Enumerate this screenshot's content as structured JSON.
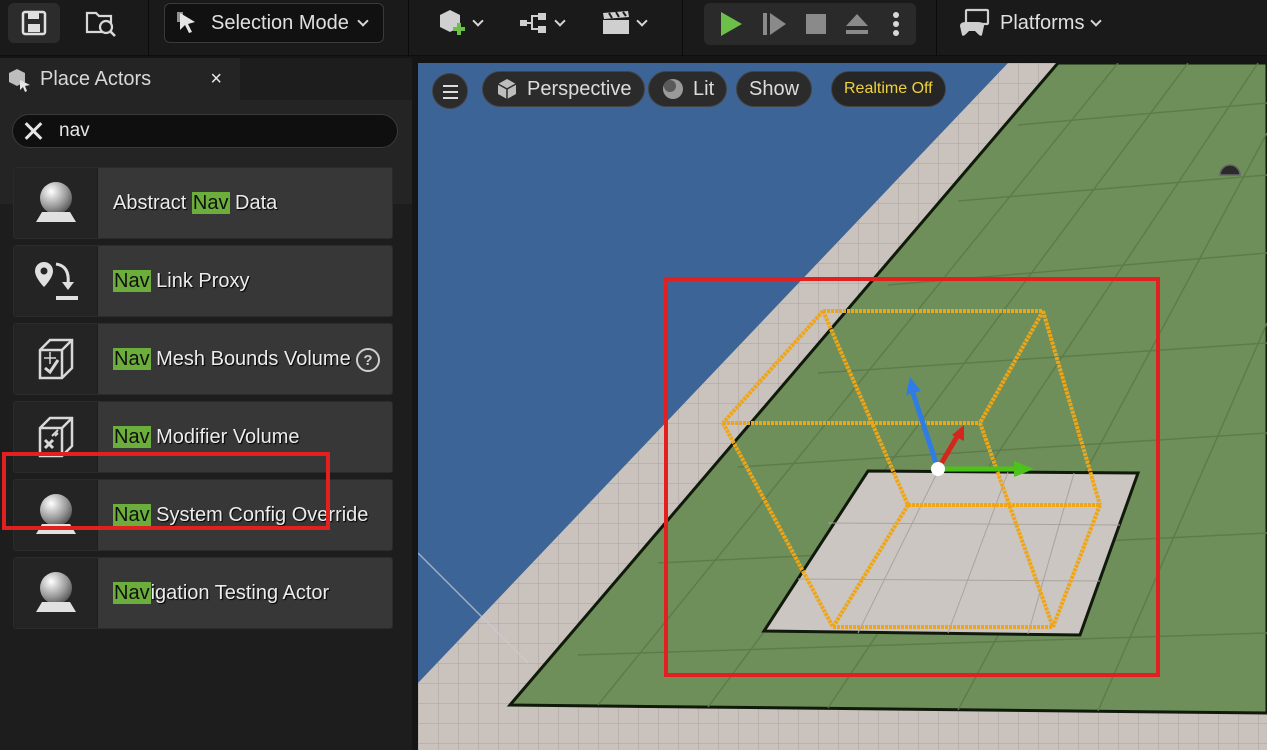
{
  "toolbar": {
    "save_icon": "save-icon",
    "content_browser_icon": "folder-search-icon",
    "selection_mode_label": "Selection Mode",
    "add_icon": "add-actor-icon",
    "blueprint_icon": "blueprint-icon",
    "cinematics_icon": "clapperboard-icon",
    "play_icon": "play-icon",
    "skip_icon": "step-forward-icon",
    "stop_icon": "stop-icon",
    "eject_icon": "eject-icon",
    "more_icon": "more-vertical-icon",
    "platforms_label": "Platforms",
    "play_color": "#6cc04a"
  },
  "panel": {
    "tab_title": "Place Actors",
    "close_label": "×",
    "search_value": "nav",
    "items": [
      {
        "pre": "Abstract ",
        "hl": "Nav",
        "post": " Data",
        "icon": "sphere-actor-icon"
      },
      {
        "pre": "",
        "hl": "Nav",
        "post": " Link Proxy",
        "icon": "nav-link-icon"
      },
      {
        "pre": "",
        "hl": "Nav",
        "post": " Mesh Bounds Volume",
        "icon": "volume-icon",
        "help": "?"
      },
      {
        "pre": "",
        "hl": "Nav",
        "post": " Modifier Volume",
        "icon": "modifier-volume-icon"
      },
      {
        "pre": "",
        "hl": "Nav",
        "post": " System Config Override",
        "icon": "sphere-actor-icon"
      },
      {
        "pre": "",
        "hl": "Nav",
        "post": "igation Testing Actor",
        "icon": "sphere-actor-icon"
      }
    ],
    "highlight_color": "#6cae3c",
    "annotation_color": "#e32020"
  },
  "viewport": {
    "menu_icon": "hamburger-icon",
    "perspective_label": "Perspective",
    "lit_label": "Lit",
    "show_label": "Show",
    "realtime_label": "Realtime Off",
    "sky_color": "#3d6496",
    "floor_color": "#6f8f5a",
    "wireframe_color": "#f0a515",
    "annotation_color": "#e32020"
  }
}
